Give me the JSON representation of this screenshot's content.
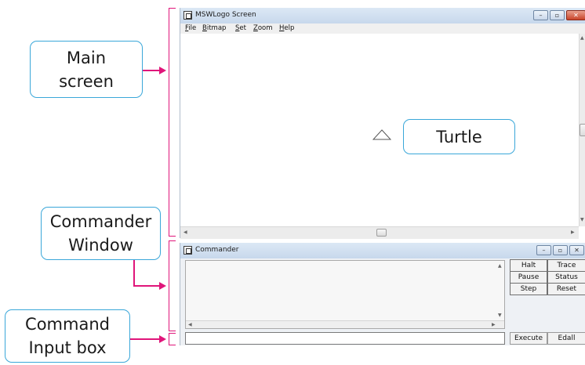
{
  "callouts": {
    "main_screen": {
      "line1": "Main",
      "line2": "screen"
    },
    "turtle": "Turtle",
    "commander_window": {
      "line1": "Commander",
      "line2": "Window"
    },
    "command_input": {
      "line1": "Command",
      "line2": "Input box"
    }
  },
  "colors": {
    "callout_border": "#3aa7d9",
    "bracket": "#e0157a",
    "titlebar": "#c7d8ec"
  },
  "msw_screen": {
    "title": "MSWLogo Screen",
    "menu": [
      {
        "hot": "F",
        "rest": "ile"
      },
      {
        "hot": "B",
        "rest": "itmap"
      },
      {
        "hot": "S",
        "rest": "et"
      },
      {
        "hot": "Z",
        "rest": "oom"
      },
      {
        "hot": "H",
        "rest": "elp"
      }
    ],
    "window_buttons": {
      "minimize": "–",
      "maximize": "▫",
      "close": "✕"
    }
  },
  "commander": {
    "title": "Commander",
    "buttons": {
      "halt": "Halt",
      "trace": "Trace",
      "pause": "Pause",
      "status": "Status",
      "step": "Step",
      "reset": "Reset",
      "execute": "Execute",
      "edall": "Edall"
    },
    "window_buttons": {
      "minimize": "–",
      "maximize": "▫",
      "close": "✕"
    }
  },
  "icons": {
    "turtle": "turtle-triangle-icon",
    "app": "app-window-icon",
    "scroll_up": "scroll-up-arrow-icon",
    "scroll_down": "scroll-down-arrow-icon",
    "scroll_left": "scroll-left-arrow-icon",
    "scroll_right": "scroll-right-arrow-icon"
  }
}
